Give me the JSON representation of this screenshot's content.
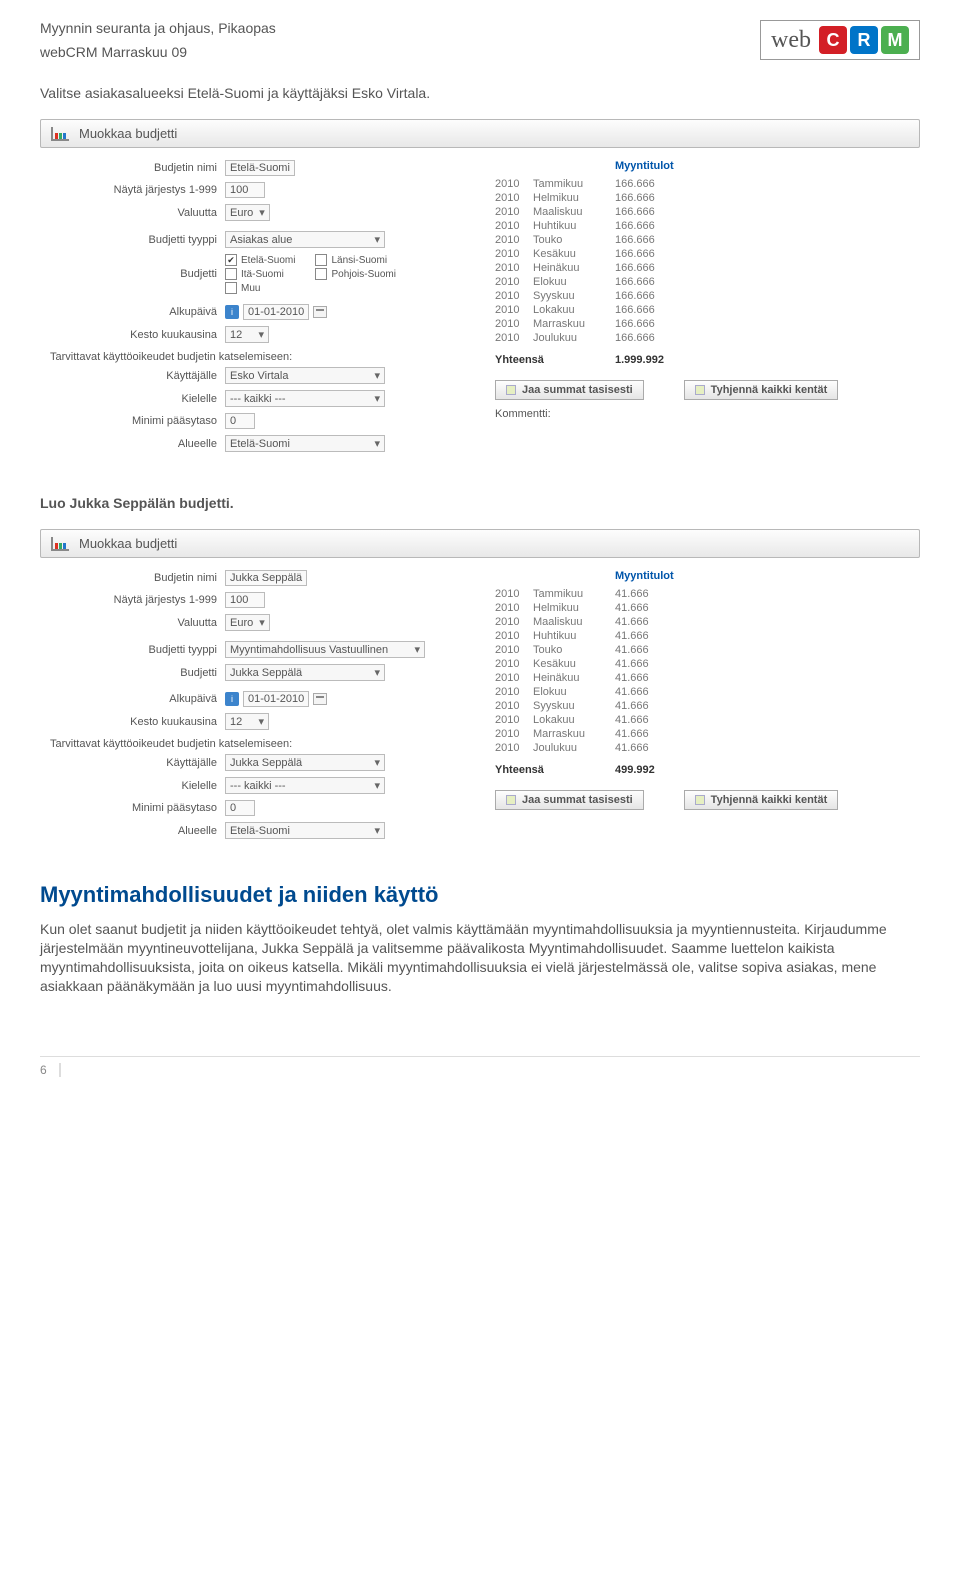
{
  "header": {
    "title": "Myynnin seuranta ja ohjaus, Pikaopas",
    "subtitle": "webCRM Marraskuu 09",
    "logo_web": "web",
    "logo_c": "C",
    "logo_r": "R",
    "logo_m": "M"
  },
  "intro1": "Valitse asiakasalueeksi Etelä-Suomi ja käyttäjäksi Esko Virtala.",
  "panel1": {
    "header": "Muokkaa budjetti",
    "labels": {
      "name": "Budjetin nimi",
      "order": "Näytä järjestys 1-999",
      "currency": "Valuutta",
      "type": "Budjetti tyyppi",
      "budget": "Budjetti",
      "start": "Alkupäivä",
      "duration": "Kesto kuukausina",
      "perm_head": "Tarvittavat käyttöoikeudet budjetin katselemiseen:",
      "user": "Käyttäjälle",
      "lang": "Kielelle",
      "min": "Minimi pääsytaso",
      "area": "Alueelle"
    },
    "values": {
      "name": "Etelä-Suomi",
      "order": "100",
      "currency": "Euro",
      "type": "Asiakas alue",
      "chk_es": "Etelä-Suomi",
      "chk_is": "Itä-Suomi",
      "chk_mu": "Muu",
      "chk_ls": "Länsi-Suomi",
      "chk_ps": "Pohjois-Suomi",
      "start": "01-01-2010",
      "duration": "12",
      "user": "Esko Virtala",
      "lang": "--- kaikki ---",
      "min": "0",
      "area": "Etelä-Suomi"
    },
    "right": {
      "title": "Myyntitulot",
      "rows": [
        {
          "y": "2010",
          "m": "Tammikuu",
          "v": "166.666"
        },
        {
          "y": "2010",
          "m": "Helmikuu",
          "v": "166.666"
        },
        {
          "y": "2010",
          "m": "Maaliskuu",
          "v": "166.666"
        },
        {
          "y": "2010",
          "m": "Huhtikuu",
          "v": "166.666"
        },
        {
          "y": "2010",
          "m": "Touko",
          "v": "166.666"
        },
        {
          "y": "2010",
          "m": "Kesäkuu",
          "v": "166.666"
        },
        {
          "y": "2010",
          "m": "Heinäkuu",
          "v": "166.666"
        },
        {
          "y": "2010",
          "m": "Elokuu",
          "v": "166.666"
        },
        {
          "y": "2010",
          "m": "Syyskuu",
          "v": "166.666"
        },
        {
          "y": "2010",
          "m": "Lokakuu",
          "v": "166.666"
        },
        {
          "y": "2010",
          "m": "Marraskuu",
          "v": "166.666"
        },
        {
          "y": "2010",
          "m": "Joulukuu",
          "v": "166.666"
        }
      ],
      "total_label": "Yhteensä",
      "total": "1.999.992",
      "btn1": "Jaa summat tasisesti",
      "btn2": "Tyhjennä kaikki kentät",
      "kommentti": "Kommentti:"
    }
  },
  "intro2": "Luo Jukka Seppälän budjetti.",
  "panel2": {
    "header": "Muokkaa budjetti",
    "labels": {
      "name": "Budjetin nimi",
      "order": "Näytä järjestys 1-999",
      "currency": "Valuutta",
      "type": "Budjetti tyyppi",
      "budget": "Budjetti",
      "start": "Alkupäivä",
      "duration": "Kesto kuukausina",
      "perm_head": "Tarvittavat käyttöoikeudet budjetin katselemiseen:",
      "user": "Käyttäjälle",
      "lang": "Kielelle",
      "min": "Minimi pääsytaso",
      "area": "Alueelle"
    },
    "values": {
      "name": "Jukka Seppälä",
      "order": "100",
      "currency": "Euro",
      "type": "Myyntimahdollisuus Vastuullinen",
      "budget": "Jukka Seppälä",
      "start": "01-01-2010",
      "duration": "12",
      "user": "Jukka Seppälä",
      "lang": "--- kaikki ---",
      "min": "0",
      "area": "Etelä-Suomi"
    },
    "right": {
      "title": "Myyntitulot",
      "rows": [
        {
          "y": "2010",
          "m": "Tammikuu",
          "v": "41.666"
        },
        {
          "y": "2010",
          "m": "Helmikuu",
          "v": "41.666"
        },
        {
          "y": "2010",
          "m": "Maaliskuu",
          "v": "41.666"
        },
        {
          "y": "2010",
          "m": "Huhtikuu",
          "v": "41.666"
        },
        {
          "y": "2010",
          "m": "Touko",
          "v": "41.666"
        },
        {
          "y": "2010",
          "m": "Kesäkuu",
          "v": "41.666"
        },
        {
          "y": "2010",
          "m": "Heinäkuu",
          "v": "41.666"
        },
        {
          "y": "2010",
          "m": "Elokuu",
          "v": "41.666"
        },
        {
          "y": "2010",
          "m": "Syyskuu",
          "v": "41.666"
        },
        {
          "y": "2010",
          "m": "Lokakuu",
          "v": "41.666"
        },
        {
          "y": "2010",
          "m": "Marraskuu",
          "v": "41.666"
        },
        {
          "y": "2010",
          "m": "Joulukuu",
          "v": "41.666"
        }
      ],
      "total_label": "Yhteensä",
      "total": "499.992",
      "btn1": "Jaa summat tasisesti",
      "btn2": "Tyhjennä kaikki kentät"
    }
  },
  "section_h": "Myyntimahdollisuudet ja niiden käyttö",
  "para1": "Kun olet saanut budjetit ja niiden käyttöoikeudet tehtyä, olet valmis käyttämään myyntimahdollisuuksia ja myyntiennusteita. Kirjaudumme järjestelmään myyntineuvottelijana, Jukka Seppälä ja valitsemme päävalikosta Myyntimahdollisuudet. Saamme luettelon kaikista myyntimahdollisuuksista, joita on oikeus katsella. Mikäli myyntimahdollisuuksia ei vielä järjestelmässä ole, valitse sopiva asiakas, mene asiakkaan päänäkymään ja luo uusi myyntimahdollisuus.",
  "page_num": "6"
}
